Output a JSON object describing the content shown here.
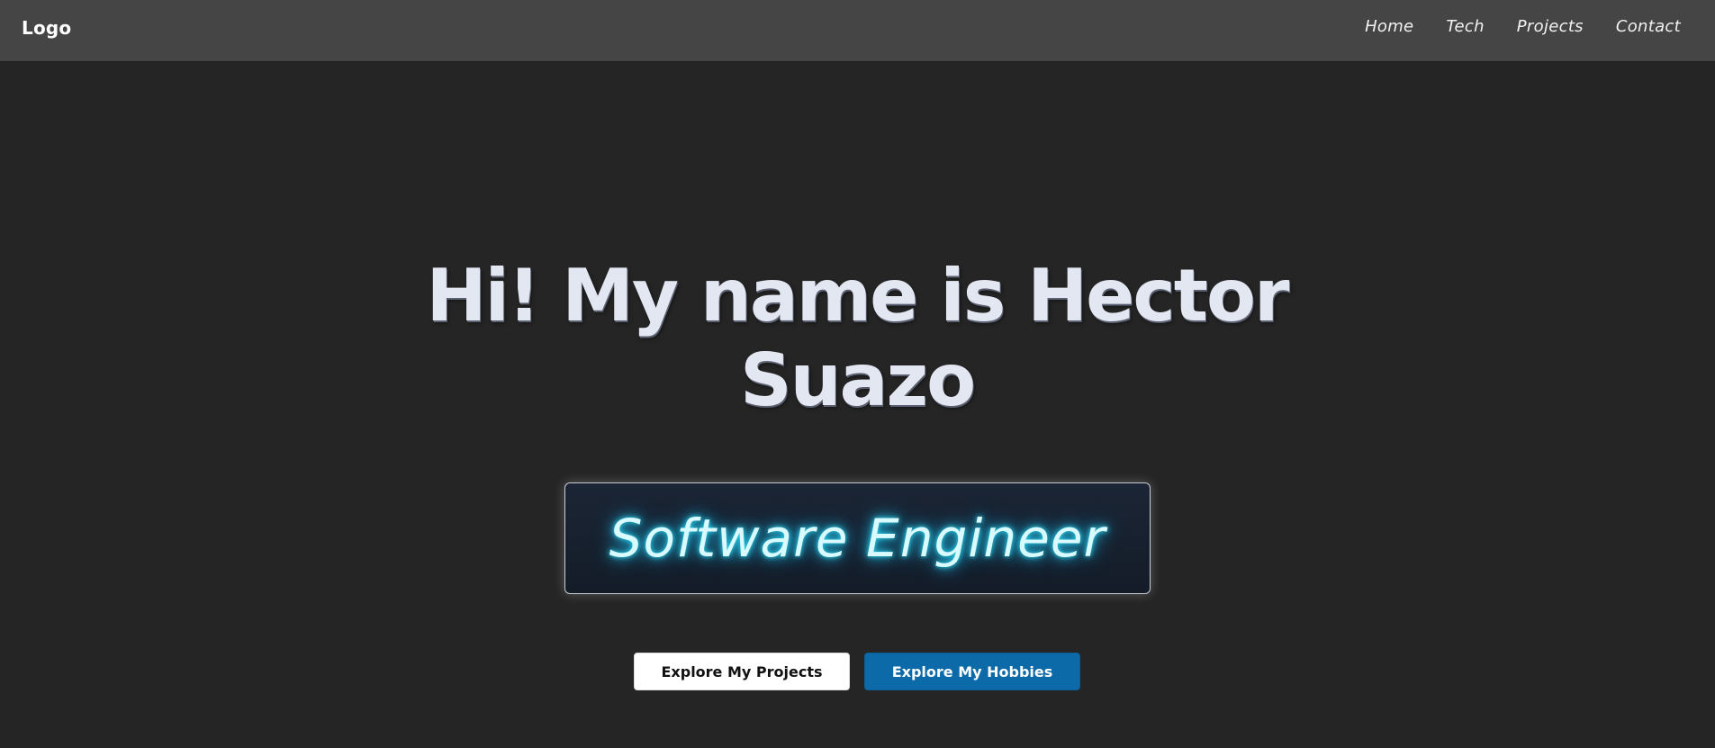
{
  "header": {
    "logo": "Logo",
    "nav": [
      {
        "label": "Home"
      },
      {
        "label": "Tech"
      },
      {
        "label": "Projects"
      },
      {
        "label": "Contact"
      }
    ]
  },
  "hero": {
    "title_line1": "Hi! My name is Hector",
    "title_line2": "Suazo",
    "role": "Software Engineer",
    "primary_button": "Explore My Projects",
    "secondary_button": "Explore My Hobbies"
  },
  "colors": {
    "background": "#252525",
    "navbar": "#454545",
    "accent_blue": "#0d6aa8",
    "neon_cyan": "#2ee6ff"
  }
}
